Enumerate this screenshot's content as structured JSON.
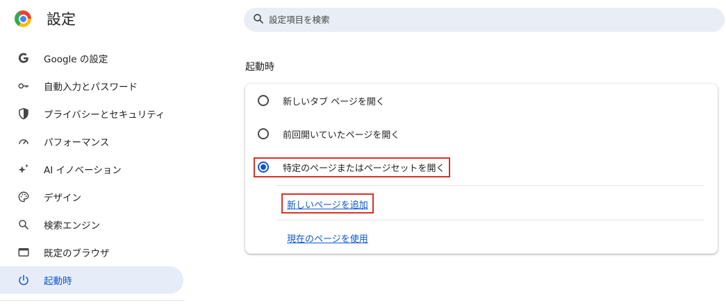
{
  "header": {
    "title": "設定",
    "search_placeholder": "設定項目を検索"
  },
  "sidebar": {
    "items": [
      {
        "label": "Google の設定",
        "icon": "google-g-icon"
      },
      {
        "label": "自動入力とパスワード",
        "icon": "key-icon"
      },
      {
        "label": "プライバシーとセキュリティ",
        "icon": "shield-icon"
      },
      {
        "label": "パフォーマンス",
        "icon": "speedometer-icon"
      },
      {
        "label": "AI イノベーション",
        "icon": "sparkle-icon"
      },
      {
        "label": "デザイン",
        "icon": "palette-icon"
      },
      {
        "label": "検索エンジン",
        "icon": "search-icon"
      },
      {
        "label": "既定のブラウザ",
        "icon": "browser-window-icon"
      },
      {
        "label": "起動時",
        "icon": "power-icon",
        "active": true
      }
    ]
  },
  "main": {
    "section_title": "起動時",
    "options": [
      {
        "label": "新しいタブ ページを開く",
        "checked": false
      },
      {
        "label": "前回開いていたページを開く",
        "checked": false
      },
      {
        "label": "特定のページまたはページセットを開く",
        "checked": true
      }
    ],
    "links": {
      "add_page": "新しいページを追加",
      "use_current": "現在のページを使用"
    }
  },
  "colors": {
    "accent": "#0b57d0",
    "active_bg": "#e7edf8",
    "search_bg": "#e9eef6",
    "highlight": "#d93025"
  }
}
